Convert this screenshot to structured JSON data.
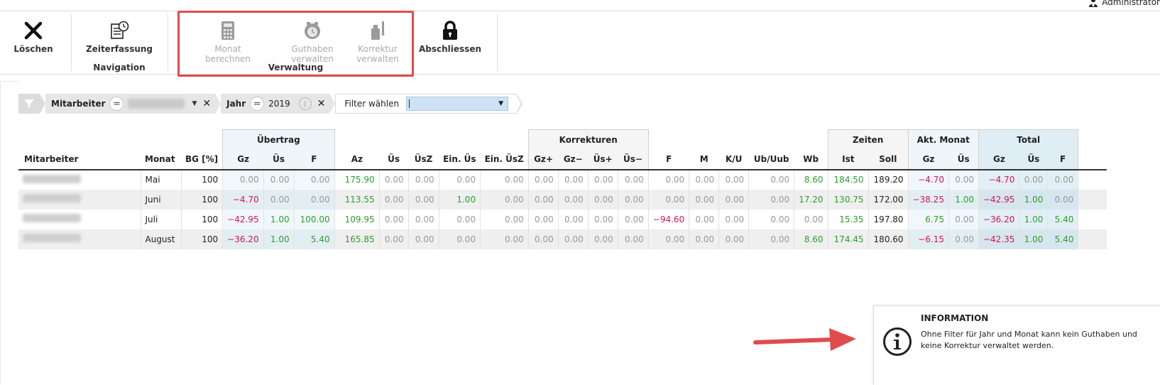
{
  "user": {
    "name": "Administrator",
    "icon": "user-icon"
  },
  "ribbon": {
    "buttons": {
      "delete": {
        "label": "Löschen",
        "icon": "close-icon"
      },
      "time": {
        "label": "Zeiterfassung",
        "icon": "timesheet-icon"
      },
      "calc": {
        "label": "Monat berechnen",
        "icon": "calculator-icon"
      },
      "credit_l1": "Guthaben",
      "credit_l2": "verwalten",
      "corr_l1": "Korrektur",
      "corr_l2": "verwalten",
      "close": {
        "label": "Abschliessen",
        "icon": "lock-icon"
      }
    },
    "groups": {
      "navigation": "Navigation",
      "verwaltung": "Verwaltung"
    }
  },
  "filter": {
    "employee_label": "Mitarbeiter",
    "year_label": "Jahr",
    "year_value": "2019",
    "choose_label": "Filter wählen"
  },
  "table": {
    "groups": {
      "ubertrag": "Übertrag",
      "korrekturen": "Korrekturen",
      "zeiten": "Zeiten",
      "akt": "Akt. Monat",
      "total": "Total"
    },
    "columns": {
      "mitarbeiter": "Mitarbeiter",
      "monat": "Monat",
      "bg": "BG [%]",
      "ub_gz": "Gz",
      "ub_us": "Üs",
      "ub_f": "F",
      "az": "Az",
      "us": "Üs",
      "usz": "ÜsZ",
      "ein_us": "Ein. Üs",
      "ein_usz": "Ein. ÜsZ",
      "gz_p": "Gz+",
      "gz_m": "Gz−",
      "us_p": "Üs+",
      "us_m": "Üs−",
      "f": "F",
      "m": "M",
      "ku": "K/U",
      "ub_uub": "Ub/Uub",
      "wb": "Wb",
      "ist": "Ist",
      "soll": "Soll",
      "ak_gz": "Gz",
      "ak_us": "Üs",
      "to_gz": "Gz",
      "to_us": "Üs",
      "to_f": "F"
    },
    "rows": [
      {
        "monat": "Mai",
        "bg": "100",
        "ub_gz": "0.00",
        "ub_us": "0.00",
        "ub_f": "0.00",
        "az": "175.90",
        "us": "0.00",
        "usz": "0.00",
        "ein_us": "0.00",
        "ein_usz": "0.00",
        "gz_p": "0.00",
        "gz_m": "0.00",
        "us_p": "0.00",
        "us_m": "0.00",
        "f": "0.00",
        "m": "0.00",
        "ku": "0.00",
        "ub_uub": "0.00",
        "wb": "8.60",
        "ist": "184.50",
        "soll": "189.20",
        "ak_gz": "−4.70",
        "ak_us": "0.00",
        "to_gz": "−4.70",
        "to_us": "0.00",
        "to_f": "0.00"
      },
      {
        "monat": "Juni",
        "bg": "100",
        "ub_gz": "−4.70",
        "ub_us": "0.00",
        "ub_f": "0.00",
        "az": "113.55",
        "us": "0.00",
        "usz": "0.00",
        "ein_us": "1.00",
        "ein_usz": "0.00",
        "gz_p": "0.00",
        "gz_m": "0.00",
        "us_p": "0.00",
        "us_m": "0.00",
        "f": "0.00",
        "m": "0.00",
        "ku": "0.00",
        "ub_uub": "0.00",
        "wb": "17.20",
        "ist": "130.75",
        "soll": "172.00",
        "ak_gz": "−38.25",
        "ak_us": "1.00",
        "to_gz": "−42.95",
        "to_us": "1.00",
        "to_f": "0.00"
      },
      {
        "monat": "Juli",
        "bg": "100",
        "ub_gz": "−42.95",
        "ub_us": "1.00",
        "ub_f": "100.00",
        "az": "109.95",
        "us": "0.00",
        "usz": "0.00",
        "ein_us": "0.00",
        "ein_usz": "0.00",
        "gz_p": "0.00",
        "gz_m": "0.00",
        "us_p": "0.00",
        "us_m": "0.00",
        "f": "−94.60",
        "m": "0.00",
        "ku": "0.00",
        "ub_uub": "0.00",
        "wb": "0.00",
        "ist": "15.35",
        "soll": "197.80",
        "ak_gz": "6.75",
        "ak_us": "0.00",
        "to_gz": "−36.20",
        "to_us": "1.00",
        "to_f": "5.40"
      },
      {
        "monat": "August",
        "bg": "100",
        "ub_gz": "−36.20",
        "ub_us": "1.00",
        "ub_f": "5.40",
        "az": "165.85",
        "us": "0.00",
        "usz": "0.00",
        "ein_us": "0.00",
        "ein_usz": "0.00",
        "gz_p": "0.00",
        "gz_m": "0.00",
        "us_p": "0.00",
        "us_m": "0.00",
        "f": "0.00",
        "m": "0.00",
        "ku": "0.00",
        "ub_uub": "0.00",
        "wb": "8.60",
        "ist": "174.45",
        "soll": "180.60",
        "ak_gz": "−6.15",
        "ak_us": "0.00",
        "to_gz": "−42.35",
        "to_us": "1.00",
        "to_f": "5.40"
      }
    ]
  },
  "info": {
    "title": "INFORMATION",
    "text": "Ohne Filter für Jahr und Monat kann kein Guthaben und keine Korrektur verwaltet werden.",
    "icon": "info-icon"
  },
  "colors": {
    "positive": "#2e9e2e",
    "negative": "#d2145a",
    "highlight": "#e04b4f",
    "muted": "#999999"
  }
}
